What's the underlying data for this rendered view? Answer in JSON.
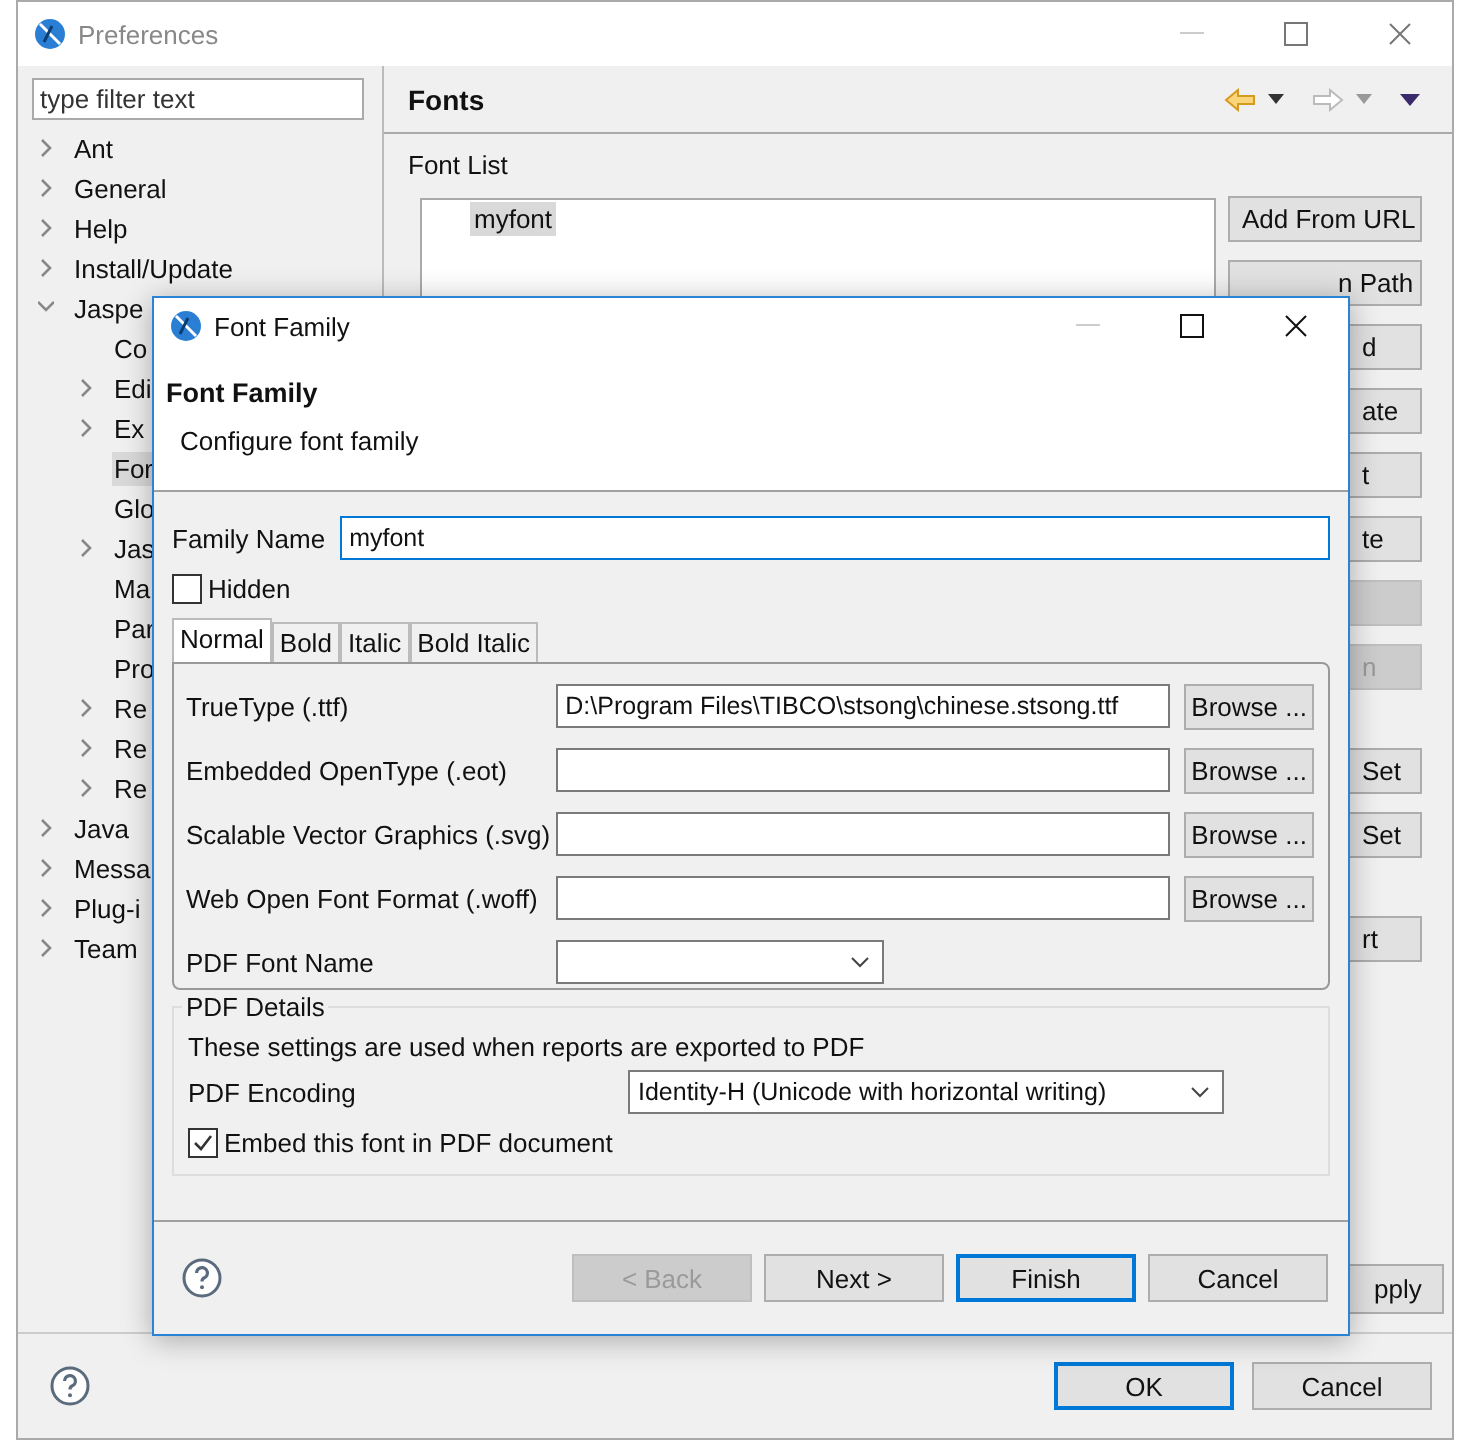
{
  "preferences": {
    "title": "Preferences",
    "filter": {
      "placeholder": "type filter text"
    },
    "tree": [
      {
        "label": "Ant",
        "kind": "branch",
        "expanded": false,
        "selected": false
      },
      {
        "label": "General",
        "kind": "branch",
        "expanded": false,
        "selected": false
      },
      {
        "label": "Help",
        "kind": "branch",
        "expanded": false,
        "selected": false
      },
      {
        "label": "Install/Update",
        "kind": "branch",
        "expanded": false,
        "selected": false
      },
      {
        "label": "Jaspe",
        "kind": "branch",
        "expanded": true,
        "selected": false,
        "children": [
          {
            "label": "Co",
            "kind": "leaf",
            "selected": false
          },
          {
            "label": "Edi",
            "kind": "branch",
            "expanded": false,
            "selected": false
          },
          {
            "label": "Ex",
            "kind": "branch",
            "expanded": false,
            "selected": false
          },
          {
            "label": "For",
            "kind": "leaf",
            "selected": true
          },
          {
            "label": "Glo",
            "kind": "leaf",
            "selected": false
          },
          {
            "label": "Jas",
            "kind": "branch",
            "expanded": false,
            "selected": false
          },
          {
            "label": "Ma",
            "kind": "leaf",
            "selected": false
          },
          {
            "label": "Par",
            "kind": "leaf",
            "selected": false
          },
          {
            "label": "Pro",
            "kind": "leaf",
            "selected": false
          },
          {
            "label": "Re",
            "kind": "branch",
            "expanded": false,
            "selected": false
          },
          {
            "label": "Re",
            "kind": "branch",
            "expanded": false,
            "selected": false
          },
          {
            "label": "Re",
            "kind": "branch",
            "expanded": false,
            "selected": false
          }
        ]
      },
      {
        "label": "Java",
        "kind": "branch",
        "expanded": false,
        "selected": false
      },
      {
        "label": "Messa",
        "kind": "branch",
        "expanded": false,
        "selected": false
      },
      {
        "label": "Plug-i",
        "kind": "branch",
        "expanded": false,
        "selected": false
      },
      {
        "label": "Team",
        "kind": "branch",
        "expanded": false,
        "selected": false
      }
    ],
    "page": {
      "title": "Fonts",
      "list_label": "Font List",
      "fonts": [
        {
          "label": "myfont",
          "selected": true
        }
      ],
      "side_buttons": [
        {
          "label": "Add From URL",
          "disabled": false
        },
        {
          "label": "n Path",
          "disabled": false
        },
        {
          "label": "d",
          "disabled": false
        },
        {
          "label": "ate",
          "disabled": false
        },
        {
          "label": "t",
          "disabled": false
        },
        {
          "label": "te",
          "disabled": false
        },
        {
          "disabled": true
        },
        {
          "label": "n",
          "disabled": true
        },
        {
          "label": "Set",
          "disabled": false
        },
        {
          "label": "Set",
          "disabled": false
        },
        {
          "label": "rt",
          "disabled": false
        }
      ],
      "apply_button": "pply"
    },
    "buttons": [
      {
        "label": "OK",
        "default": true
      },
      {
        "label": "Cancel",
        "default": false
      }
    ]
  },
  "dialog": {
    "title": "Font Family",
    "heading": "Font Family",
    "description": "Configure font family",
    "family_name": {
      "label": "Family Name",
      "value": "myfont"
    },
    "hidden": {
      "label": "Hidden",
      "checked": false
    },
    "tabs": [
      {
        "label": "Normal",
        "selected": true
      },
      {
        "label": "Bold",
        "selected": false
      },
      {
        "label": "Italic",
        "selected": false
      },
      {
        "label": "Bold Italic",
        "selected": false
      }
    ],
    "rows": [
      {
        "kind": "file",
        "label": "TrueType (.ttf)",
        "value": "D:\\Program Files\\TIBCO\\stsong\\chinese.stsong.ttf",
        "button": "Browse ..."
      },
      {
        "kind": "file",
        "label": "Embedded OpenType (.eot)",
        "button": "Browse ..."
      },
      {
        "kind": "file",
        "label": "Scalable Vector Graphics (.svg)",
        "button": "Browse ..."
      },
      {
        "kind": "file",
        "label": "Web Open Font Format (.woff)",
        "button": "Browse ..."
      },
      {
        "kind": "combo",
        "label": "PDF Font Name"
      }
    ],
    "pdf": {
      "title": "PDF Details",
      "note": "These settings are used when reports are exported to PDF",
      "encoding_label": "PDF Encoding",
      "encoding": "Identity-H (Unicode with horizontal writing)",
      "embed": {
        "label": "Embed this font in PDF document",
        "checked": true
      }
    },
    "buttons": [
      {
        "label": "< Back",
        "disabled": true,
        "default": false
      },
      {
        "label": "Next >",
        "disabled": false,
        "default": false
      },
      {
        "label": "Finish",
        "disabled": false,
        "default": true
      },
      {
        "label": "Cancel",
        "disabled": false,
        "default": false
      }
    ]
  }
}
